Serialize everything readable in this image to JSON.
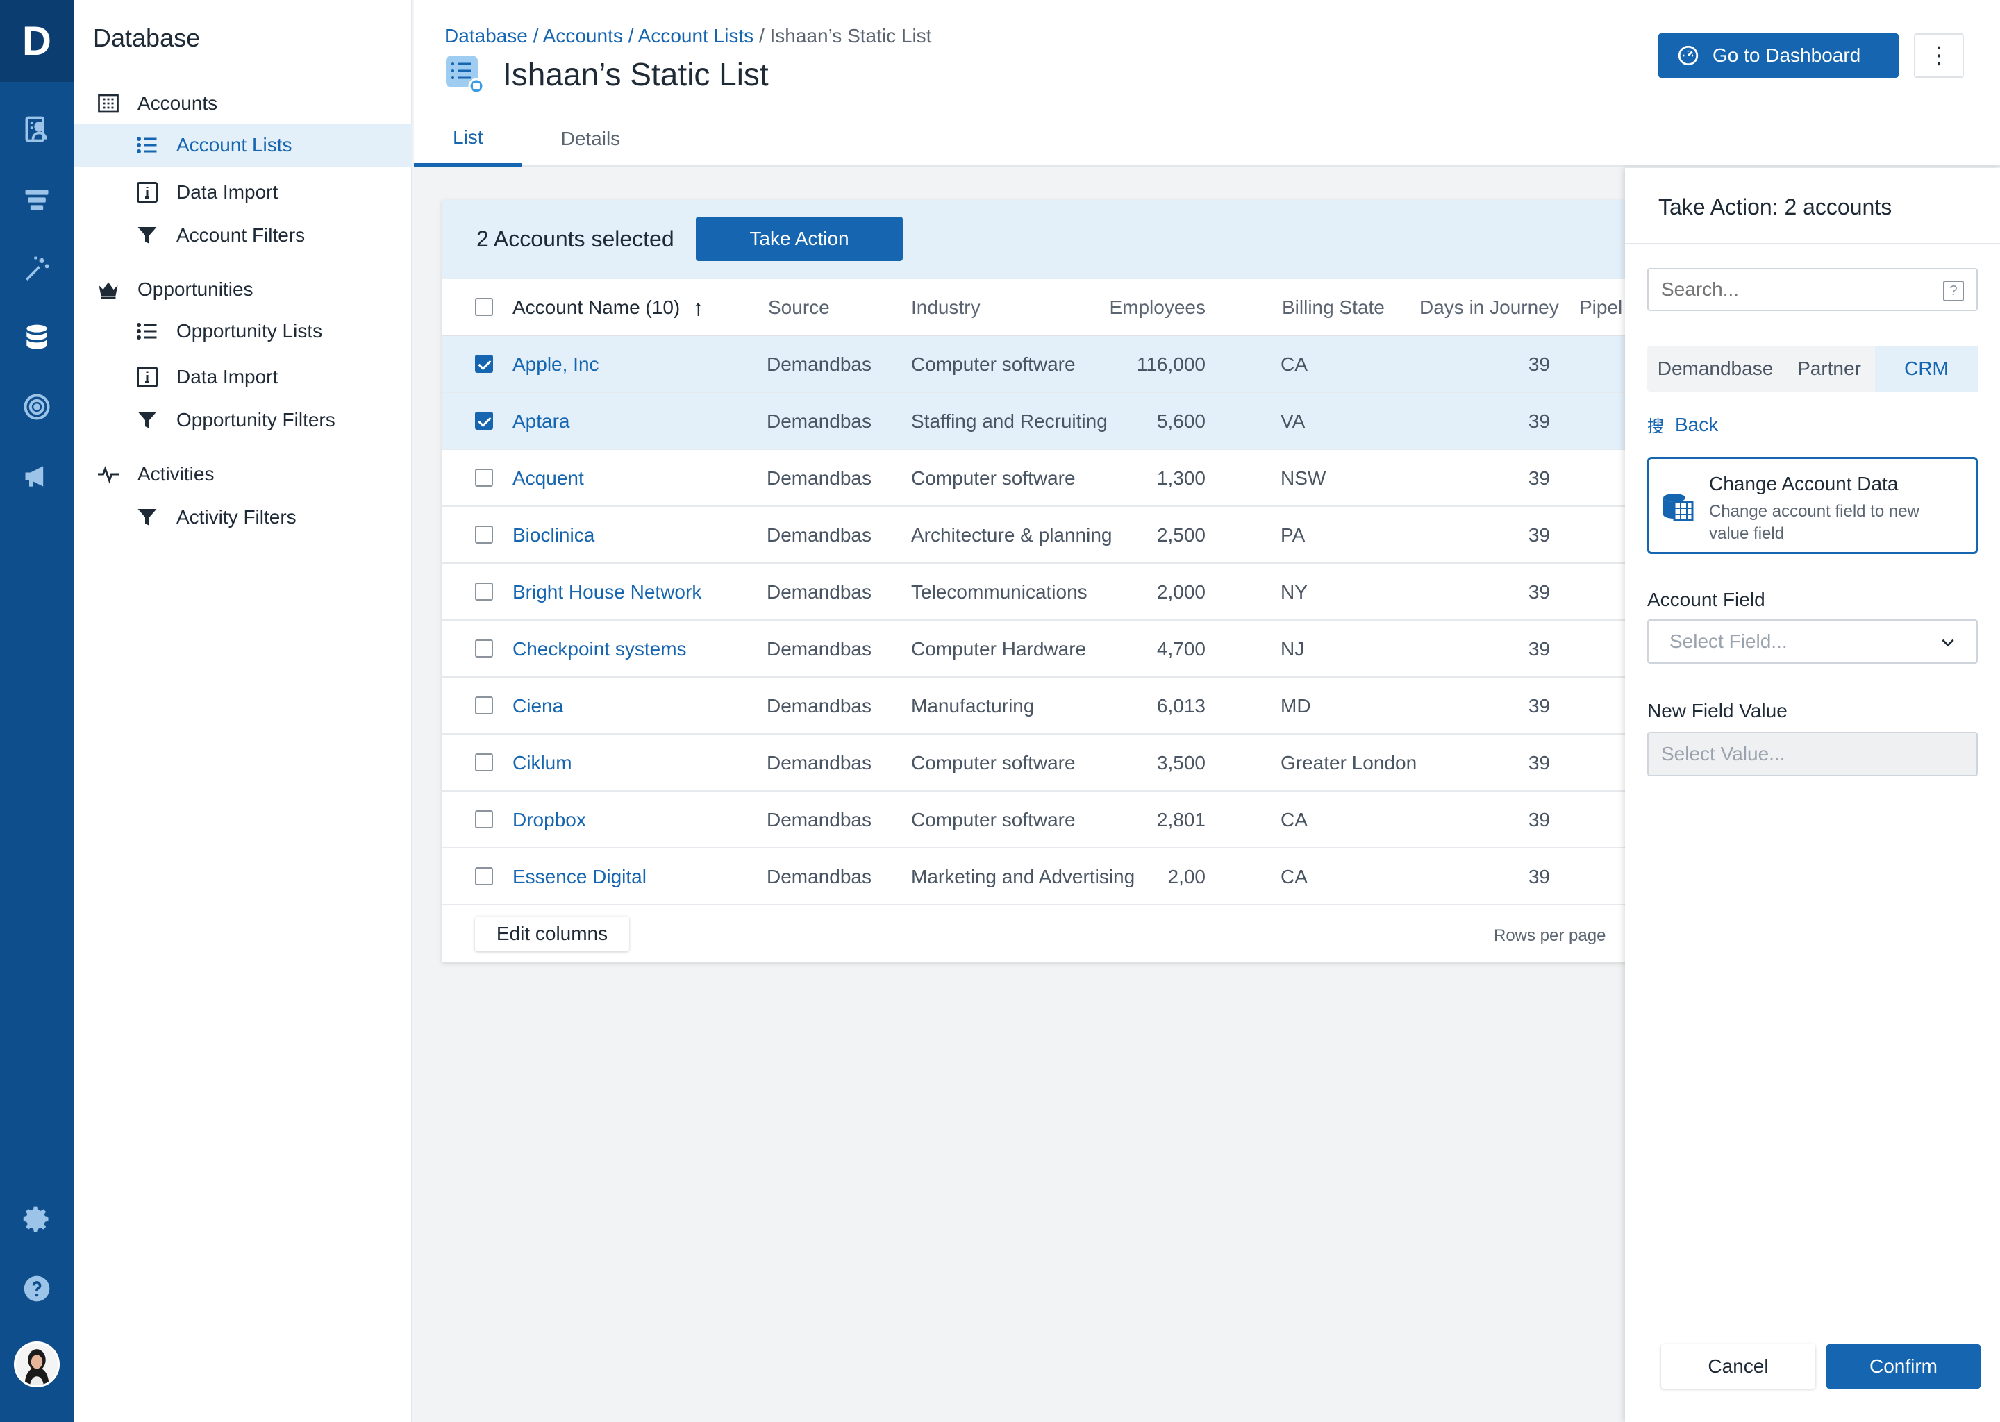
{
  "app": {
    "logo_letter": "D",
    "rail_icons": [
      "account-id-icon",
      "funnel-stack-icon",
      "magic-wand-icon",
      "database-icon",
      "target-icon",
      "megaphone-icon",
      "gear-icon",
      "help-icon"
    ]
  },
  "nav": {
    "title": "Database",
    "items": [
      {
        "label": "Accounts",
        "icon": "building-icon",
        "level": 1
      },
      {
        "label": "Account Lists",
        "icon": "list-icon",
        "level": 2,
        "active": true
      },
      {
        "label": "Data Import",
        "icon": "import-icon",
        "level": 2
      },
      {
        "label": "Account Filters",
        "icon": "filter-icon",
        "level": 2
      },
      {
        "label": "Opportunities",
        "icon": "crown-icon",
        "level": 1
      },
      {
        "label": "Opportunity Lists",
        "icon": "list-icon",
        "level": 2
      },
      {
        "label": "Data Import",
        "icon": "import-icon",
        "level": 2
      },
      {
        "label": "Opportunity Filters",
        "icon": "filter-icon",
        "level": 2
      },
      {
        "label": "Activities",
        "icon": "pulse-icon",
        "level": 1
      },
      {
        "label": "Activity Filters",
        "icon": "filter-icon",
        "level": 2
      }
    ]
  },
  "header": {
    "breadcrumb": {
      "crumb1": "Database",
      "crumb2": "Accounts",
      "crumb3": "Account Lists",
      "current": "Ishaan’s Static List",
      "sep": " / "
    },
    "title": "Ishaan’s Static List",
    "tabs": [
      {
        "label": "List",
        "active": true
      },
      {
        "label": "Details",
        "active": false
      }
    ],
    "dashboard_button": "Go to Dashboard",
    "more_button": "⋮"
  },
  "table": {
    "selected_text": "2 Accounts selected",
    "take_action_label": "Take Action",
    "columns": {
      "name": "Account Name (10)",
      "source": "Source",
      "industry": "Industry",
      "employees": "Employees",
      "billing_state": "Billing State",
      "days": "Days in Journey",
      "pipeline": "Pipel"
    },
    "sort_indicator": "↑",
    "rows": [
      {
        "name": "Apple, Inc",
        "source": "Demandbas",
        "industry": "Computer software",
        "employees": "116,000",
        "state": "CA",
        "days": "39",
        "checked": true
      },
      {
        "name": "Aptara",
        "source": "Demandbas",
        "industry": "Staffing and Recruiting",
        "employees": "5,600",
        "state": "VA",
        "days": "39",
        "checked": true
      },
      {
        "name": "Acquent",
        "source": "Demandbas",
        "industry": "Computer software",
        "employees": "1,300",
        "state": "NSW",
        "days": "39",
        "checked": false
      },
      {
        "name": "Bioclinica",
        "source": "Demandbas",
        "industry": "Architecture & planning",
        "employees": "2,500",
        "state": "PA",
        "days": "39",
        "checked": false
      },
      {
        "name": "Bright House Network",
        "source": "Demandbas",
        "industry": "Telecommunications",
        "employees": "2,000",
        "state": "NY",
        "days": "39",
        "checked": false
      },
      {
        "name": "Checkpoint systems",
        "source": "Demandbas",
        "industry": "Computer Hardware",
        "employees": "4,700",
        "state": "NJ",
        "days": "39",
        "checked": false
      },
      {
        "name": "Ciena",
        "source": "Demandbas",
        "industry": "Manufacturing",
        "employees": "6,013",
        "state": "MD",
        "days": "39",
        "checked": false
      },
      {
        "name": "Ciklum",
        "source": "Demandbas",
        "industry": "Computer software",
        "employees": "3,500",
        "state": "Greater London",
        "days": "39",
        "checked": false
      },
      {
        "name": "Dropbox",
        "source": "Demandbas",
        "industry": "Computer software",
        "employees": "2,801",
        "state": "CA",
        "days": "39",
        "checked": false
      },
      {
        "name": "Essence Digital",
        "source": "Demandbas",
        "industry": "Marketing and Advertising",
        "employees": "2,00",
        "state": "CA",
        "days": "39",
        "checked": false
      }
    ],
    "edit_columns_label": "Edit columns",
    "rows_per_page_label": "Rows per page"
  },
  "panel": {
    "title": "Take Action: 2 accounts",
    "search_placeholder": "Search...",
    "search_help": "?",
    "segments": [
      {
        "label": "Demandbase",
        "active": false
      },
      {
        "label": "Partner",
        "active": false
      },
      {
        "label": "CRM",
        "active": true
      }
    ],
    "back_icon_glyph": "搜",
    "back_label": "Back",
    "option": {
      "title": "Change Account Data",
      "description": "Change account field to new value field"
    },
    "account_field_label": "Account Field",
    "account_field_placeholder": "Select Field...",
    "new_value_label": "New Field Value",
    "new_value_placeholder": "Select Value...",
    "cancel_label": "Cancel",
    "confirm_label": "Confirm"
  },
  "colors": {
    "brand": "#1565b0",
    "rail": "#0f4e8c",
    "selected_row": "#e3eff9"
  }
}
